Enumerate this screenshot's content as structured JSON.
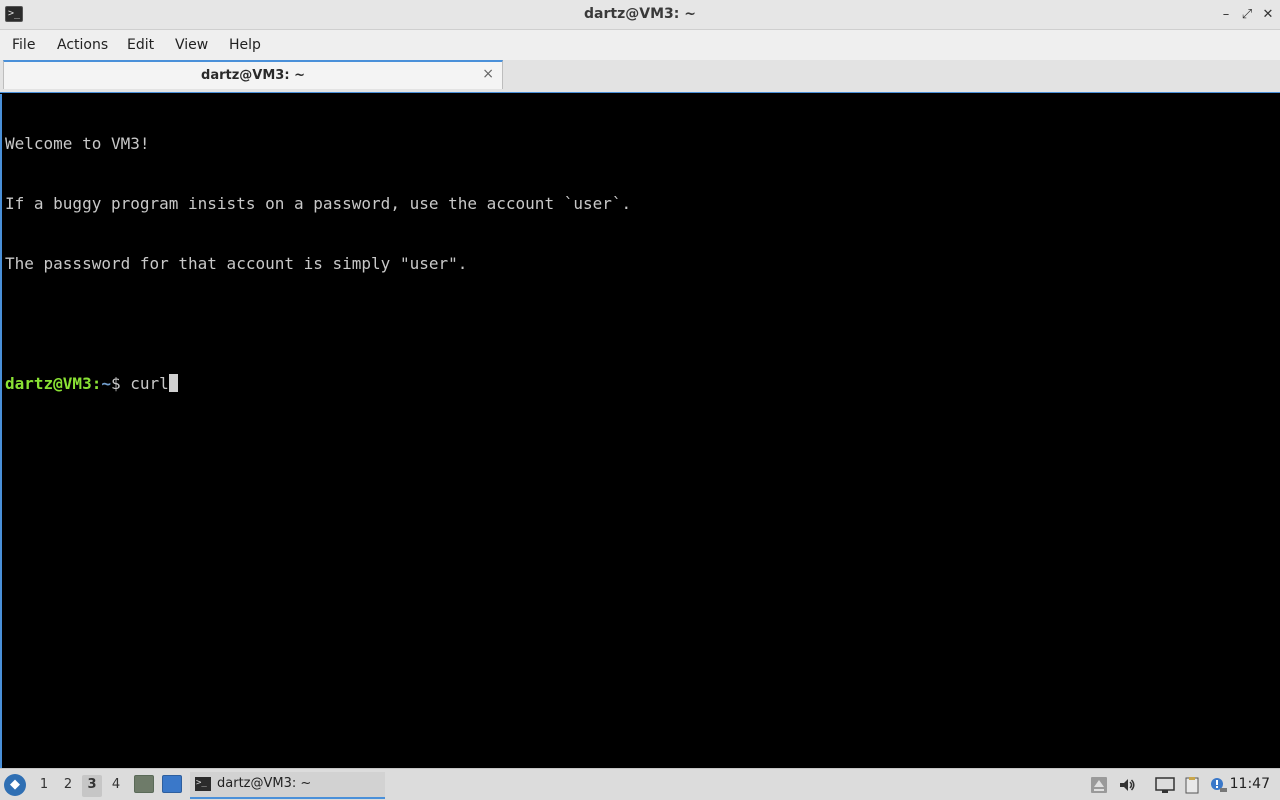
{
  "window": {
    "title": "dartz@VM3: ~",
    "app_icon_glyph": ">_",
    "controls": {
      "minimize": "–",
      "maximize": "⤢",
      "close": "✕"
    }
  },
  "menubar": {
    "items": [
      "File",
      "Actions",
      "Edit",
      "View",
      "Help"
    ]
  },
  "tabs": [
    {
      "label": "dartz@VM3: ~",
      "close_glyph": "×",
      "active": true
    }
  ],
  "terminal": {
    "lines": [
      "Welcome to VM3!",
      "If a buggy program insists on a password, use the account `user`.",
      "The passsword for that account is simply \"user\".",
      ""
    ],
    "prompt": {
      "user_host": "dartz@VM3",
      "separator": ":",
      "path": "~",
      "symbol": "$ ",
      "command": "curl"
    }
  },
  "taskbar": {
    "start_icon": "start-menu-icon",
    "workspaces": [
      "1",
      "2",
      "3",
      "4"
    ],
    "active_workspace": "3",
    "task": {
      "label": "dartz@VM3: ~",
      "icon_glyph": ">_"
    },
    "tray": [
      "upload-icon",
      "volume-icon",
      "network-icon",
      "clipboard-icon",
      "notification-icon"
    ],
    "clock": "11:47"
  },
  "colors": {
    "accent": "#4a90d9",
    "prompt_user": "#8ae234",
    "prompt_path": "#729fcf",
    "terminal_bg": "#000000",
    "terminal_fg": "#c8c8c8"
  }
}
